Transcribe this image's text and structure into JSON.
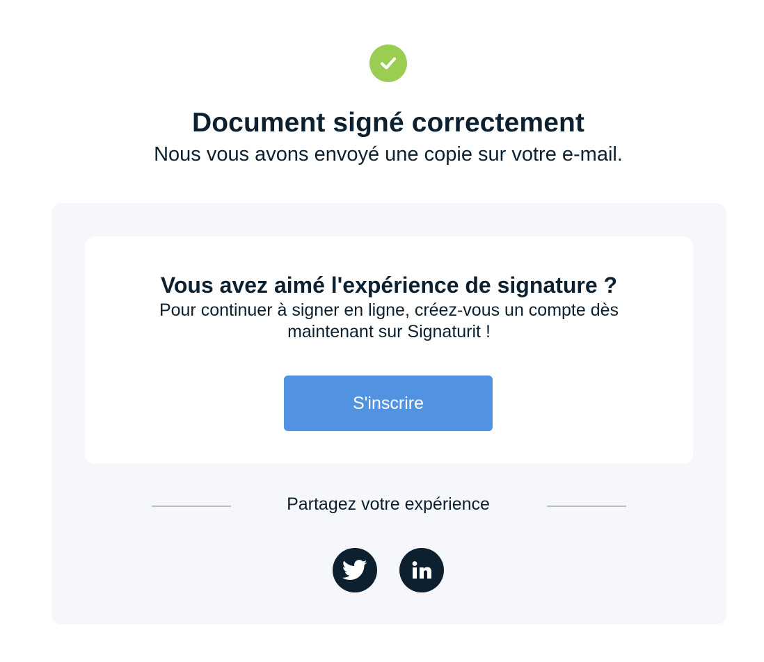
{
  "confirmation": {
    "icon": "check-circle-icon",
    "title": "Document signé correctement",
    "subtitle": "Nous vous avons envoyé une copie sur votre e-mail."
  },
  "promo": {
    "title": "Vous avez aimé l'expérience de signature ?",
    "text": "Pour continuer à signer en ligne, créez-vous un compte dès maintenant sur Signaturit !",
    "button_label": "S'inscrire"
  },
  "share": {
    "label": "Partagez votre expérience",
    "networks": [
      {
        "name": "Twitter",
        "icon": "twitter-icon"
      },
      {
        "name": "LinkedIn",
        "icon": "linkedin-icon"
      }
    ]
  },
  "colors": {
    "success": "#9acd52",
    "primary_button": "#5193e1",
    "text_dark": "#0d2030",
    "panel_background": "#f6f7fa"
  }
}
